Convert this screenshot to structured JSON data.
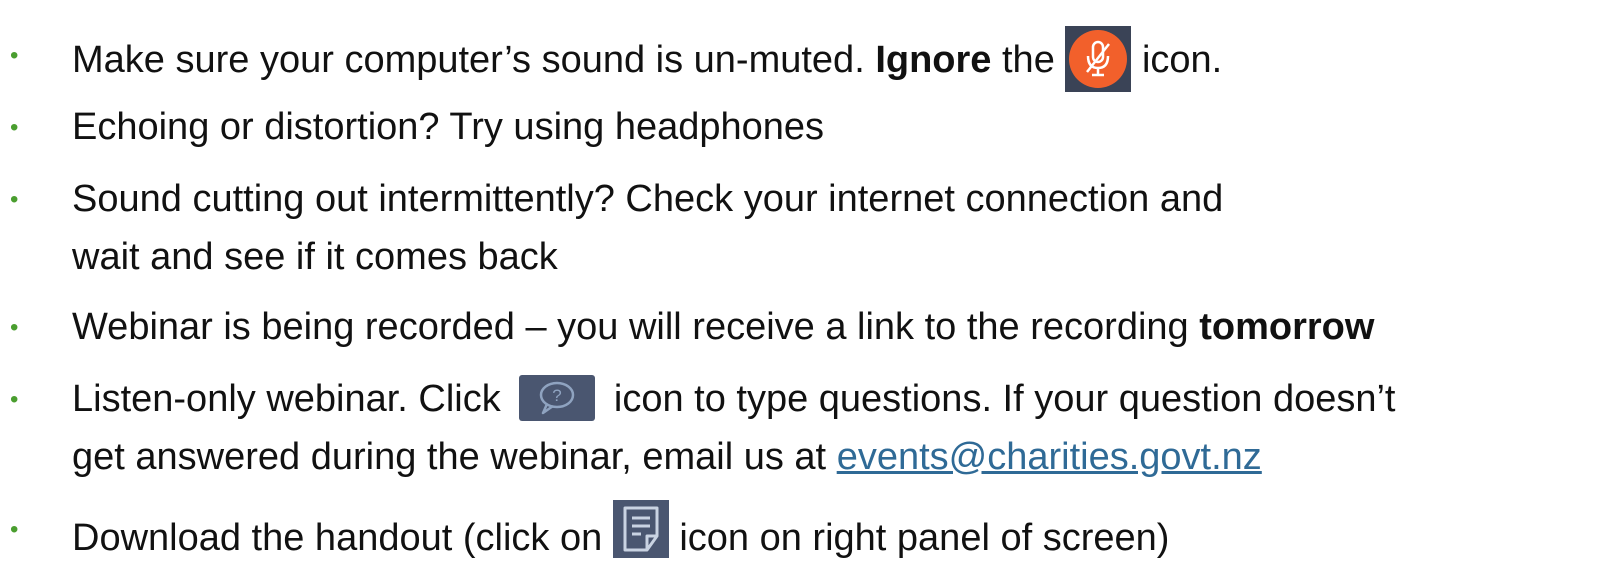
{
  "bullet_char": "•",
  "bullet_color": "#4a9e2f",
  "link_color": "#2f6a96",
  "items": [
    {
      "pre": "Make sure your computer’s sound is un-muted.",
      "bold": "Ignore",
      "mid": "the",
      "icon": "muted-microphone-icon",
      "post": "icon."
    },
    {
      "text": "Echoing or distortion? Try using headphones"
    },
    {
      "line1": "Sound cutting out intermittently? Check your internet connection and",
      "line2": "wait and see if it comes back"
    },
    {
      "pre": "Webinar is being recorded – you will receive a link to the recording",
      "bold": "tomorrow"
    },
    {
      "pre": "Listen-only webinar. Click",
      "icon": "questions-chat-icon",
      "post": "icon to type questions. If your question doesn’t",
      "line2_pre": "get answered during the webinar, email us at",
      "email": "events@charities.govt.nz"
    },
    {
      "pre": "Download the handout (click on",
      "icon": "handout-document-icon",
      "post": "icon on right panel of screen)"
    }
  ]
}
